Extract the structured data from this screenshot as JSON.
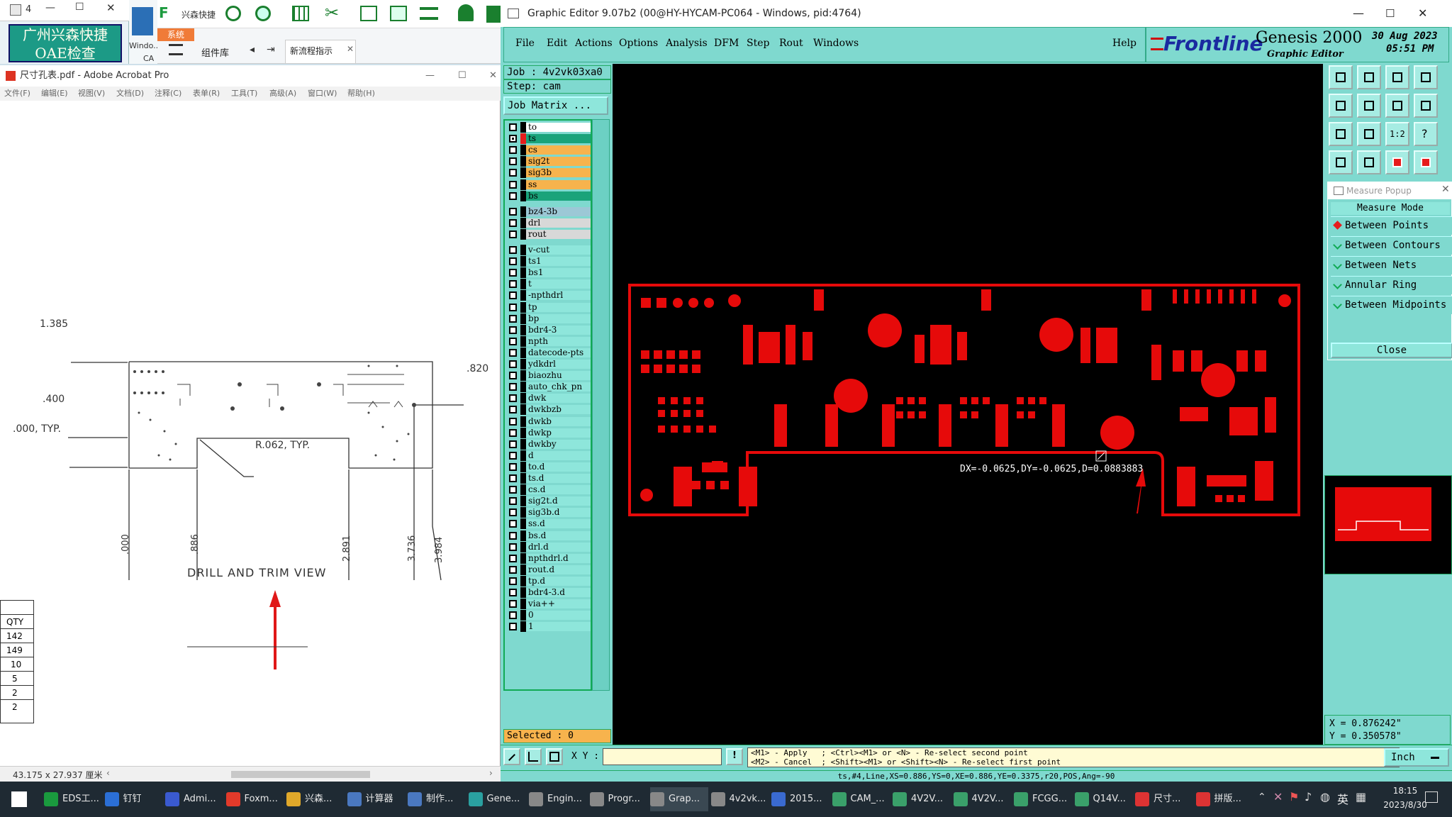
{
  "top_left": {
    "window_title": "4",
    "oae_text": "广州兴森快捷 OAE检查",
    "desktop_label": "Windo...",
    "desktop_label2": "CA",
    "app_name": "兴森快捷",
    "sys_tab": "系统",
    "component_lib": "组件库",
    "new_flow": "新流程指示"
  },
  "acrobat": {
    "title": "尺寸孔表.pdf - Adobe Acrobat Pro",
    "menu": [
      "文件(F)",
      "编辑(E)",
      "视图(V)",
      "文档(D)",
      "注释(C)",
      "表单(R)",
      "工具(T)",
      "高级(A)",
      "窗口(W)",
      "帮助(H)"
    ],
    "dims": {
      "d1385": "1.385",
      "d400": ".400",
      "d000typ": ".000, TYP.",
      "r062": "R.062, TYP.",
      "d820": ".820",
      "x000": ".000",
      "x886": ".886",
      "x2891": "2.891",
      "x3736": "3.736",
      "x3984": "3.984"
    },
    "view_title": "DRILL AND TRIM VIEW",
    "qty_header": "QTY",
    "qty_values": [
      "142",
      "149",
      "10",
      "5",
      "2",
      "2"
    ],
    "status_size": "43.175 x 27.937 厘米"
  },
  "genesis": {
    "title": "Graphic Editor 9.07b2 (00@HY-HYCAM-PC064 - Windows, pid:4764)",
    "menu": [
      "File",
      "Edit",
      "Actions",
      "Options",
      "Analysis",
      "DFM",
      "Step",
      "Rout",
      "Windows"
    ],
    "help": "Help",
    "brand": "Frontline",
    "brand_product": "Genesis 2000",
    "brand_sub": "Graphic Editor",
    "date": "30 Aug 2023",
    "time": "05:51 PM",
    "job": "Job : 4v2vk03xa0",
    "step": "Step: cam",
    "job_matrix": "Job Matrix ...",
    "layers": [
      {
        "name": "to",
        "color": "#ffffff",
        "stripe": "#000000"
      },
      {
        "name": "ts",
        "color": "#1aa37a",
        "stripe": "#e61c1c",
        "selected": true
      },
      {
        "name": "cs",
        "color": "#f7b34d",
        "stripe": "#000000"
      },
      {
        "name": "sig2t",
        "color": "#f7b34d",
        "stripe": "#000000"
      },
      {
        "name": "sig3b",
        "color": "#f7b34d",
        "stripe": "#000000"
      },
      {
        "name": "ss",
        "color": "#f7b34d",
        "stripe": "#000000"
      },
      {
        "name": "bs",
        "color": "#1aa37a",
        "stripe": "#000000"
      },
      {
        "name": "bz4-3b",
        "color": "#9cc8d6",
        "stripe": "#000000"
      },
      {
        "name": "drl",
        "color": "#d8d8d8",
        "stripe": "#000000"
      },
      {
        "name": "rout",
        "color": "#d8d8d8",
        "stripe": "#000000"
      },
      {
        "name": "v-cut",
        "color": "#8ee6db",
        "stripe": "#000000"
      },
      {
        "name": "ts1",
        "color": "#8ee6db",
        "stripe": "#000000"
      },
      {
        "name": "bs1",
        "color": "#8ee6db",
        "stripe": "#000000"
      },
      {
        "name": "t",
        "color": "#8ee6db",
        "stripe": "#000000"
      },
      {
        "name": "-npthdrl",
        "color": "#8ee6db",
        "stripe": "#000000"
      },
      {
        "name": "tp",
        "color": "#8ee6db",
        "stripe": "#000000"
      },
      {
        "name": "bp",
        "color": "#8ee6db",
        "stripe": "#000000"
      },
      {
        "name": "bdr4-3",
        "color": "#8ee6db",
        "stripe": "#000000"
      },
      {
        "name": "npth",
        "color": "#8ee6db",
        "stripe": "#000000"
      },
      {
        "name": "datecode-pts",
        "color": "#8ee6db",
        "stripe": "#000000"
      },
      {
        "name": "ydkdrl",
        "color": "#8ee6db",
        "stripe": "#000000"
      },
      {
        "name": "biaozhu",
        "color": "#8ee6db",
        "stripe": "#000000"
      },
      {
        "name": "auto_chk_pn",
        "color": "#8ee6db",
        "stripe": "#000000"
      },
      {
        "name": "dwk",
        "color": "#8ee6db",
        "stripe": "#000000"
      },
      {
        "name": "dwkbzb",
        "color": "#8ee6db",
        "stripe": "#000000"
      },
      {
        "name": "dwkb",
        "color": "#8ee6db",
        "stripe": "#000000"
      },
      {
        "name": "dwkp",
        "color": "#8ee6db",
        "stripe": "#000000"
      },
      {
        "name": "dwkby",
        "color": "#8ee6db",
        "stripe": "#000000"
      },
      {
        "name": "d",
        "color": "#8ee6db",
        "stripe": "#000000"
      },
      {
        "name": "to.d",
        "color": "#8ee6db",
        "stripe": "#000000"
      },
      {
        "name": "ts.d",
        "color": "#8ee6db",
        "stripe": "#000000"
      },
      {
        "name": "cs.d",
        "color": "#8ee6db",
        "stripe": "#000000"
      },
      {
        "name": "sig2t.d",
        "color": "#8ee6db",
        "stripe": "#000000"
      },
      {
        "name": "sig3b.d",
        "color": "#8ee6db",
        "stripe": "#000000"
      },
      {
        "name": "ss.d",
        "color": "#8ee6db",
        "stripe": "#000000"
      },
      {
        "name": "bs.d",
        "color": "#8ee6db",
        "stripe": "#000000"
      },
      {
        "name": "drl.d",
        "color": "#8ee6db",
        "stripe": "#000000"
      },
      {
        "name": "npthdrl.d",
        "color": "#8ee6db",
        "stripe": "#000000"
      },
      {
        "name": "rout.d",
        "color": "#8ee6db",
        "stripe": "#000000"
      },
      {
        "name": "tp.d",
        "color": "#8ee6db",
        "stripe": "#000000"
      },
      {
        "name": "bdr4-3.d",
        "color": "#8ee6db",
        "stripe": "#000000"
      },
      {
        "name": "via++",
        "color": "#8ee6db",
        "stripe": "#000000"
      },
      {
        "name": "0",
        "color": "#8ee6db",
        "stripe": "#000000"
      },
      {
        "name": "1",
        "color": "#8ee6db",
        "stripe": "#000000"
      }
    ],
    "selected": "Selected : 0",
    "measure_readout": "DX=-0.0625,DY=-0.0625,D=0.0883883",
    "measure_popup": {
      "title": "Measure Popup",
      "mode_label": "Measure Mode",
      "options": [
        "Between Points",
        "Between Contours",
        "Between Nets",
        "Annular Ring",
        "Between Midpoints"
      ],
      "active_option": "Between Points",
      "close": "Close"
    },
    "tool_ratio": "1:2",
    "coord_x": "X = 0.876242\"",
    "coord_y": "Y = 0.350578\"",
    "xy_label": "X Y :",
    "xy_value": "",
    "hint_line1": "<M1> - Apply   ; <Ctrl><M1> or <N> - Re-select second point",
    "hint_line2": "<M2> - Cancel  ; <Shift><M1> or <Shift><N> - Re-select first point",
    "unit": "Inch",
    "status": "ts,#4,Line,XS=0.886,YS=0,XE=0.886,YE=0.3375,r20,POS,Ang=-90",
    "board_color": "#e60a0a"
  },
  "taskbar": {
    "items": [
      "EDS工...",
      "钉钉",
      "Admi...",
      "Foxm...",
      "兴森...",
      "计算器",
      "制作...",
      "Gene...",
      "Engin...",
      "Progr...",
      "Grap...",
      "4v2vk...",
      "2015...",
      "CAM_...",
      "4V2V...",
      "4V2V...",
      "FCGG...",
      "Q14V...",
      "尺寸...",
      "拼版..."
    ],
    "lang": "英",
    "time": "18:15",
    "date": "2023/8/30"
  }
}
